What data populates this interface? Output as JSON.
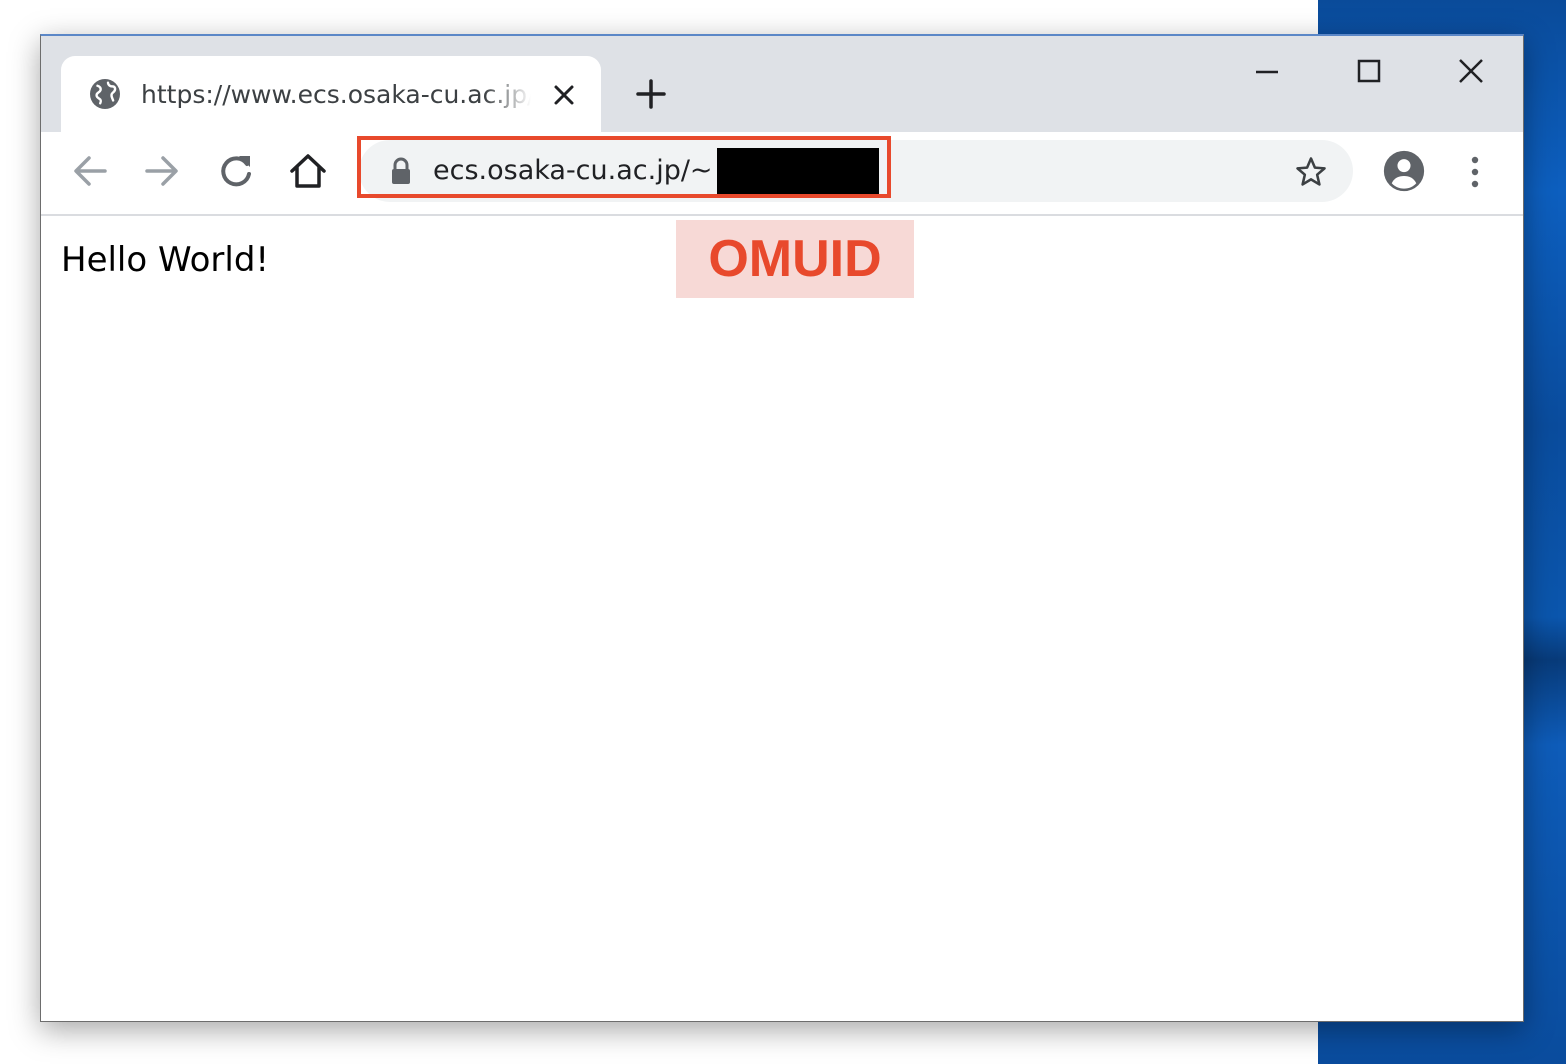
{
  "browser": {
    "tab": {
      "title": "https://www.ecs.osaka-cu.ac.jp/~",
      "icon": "globe-icon",
      "close_icon": "close-icon"
    },
    "new_tab_icon": "plus-icon",
    "window_controls": [
      "minimize-icon",
      "maximize-icon",
      "close-icon"
    ],
    "toolbar": {
      "icons": [
        "back-arrow-icon",
        "forward-arrow-icon",
        "reload-icon",
        "home-icon"
      ],
      "address": {
        "secure_icon": "lock-icon",
        "url": "ecs.osaka-cu.ac.jp/~",
        "bookmark_icon": "star-icon"
      },
      "profile_icon": "account-circle-icon",
      "menu_icon": "vertical-dots-icon"
    }
  },
  "page": {
    "text": "Hello World!"
  },
  "annotation": {
    "label": "OMUID",
    "colors": {
      "accent": "#e8492c",
      "label_background": "#f7d9d6"
    }
  }
}
